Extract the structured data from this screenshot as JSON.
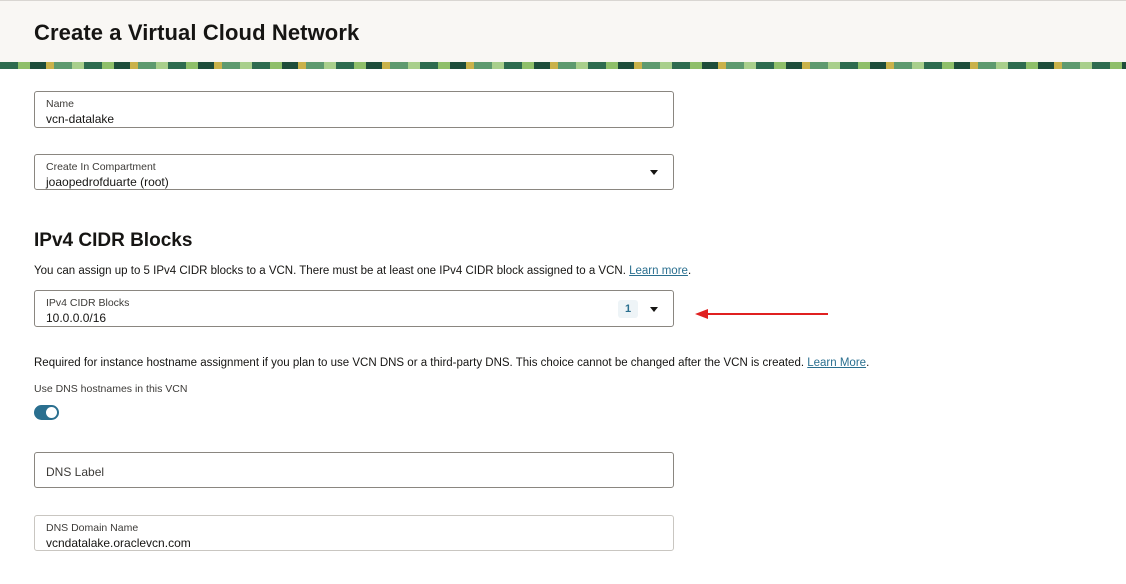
{
  "header": {
    "title": "Create a Virtual Cloud Network"
  },
  "form": {
    "name": {
      "label": "Name",
      "value": "vcn-datalake"
    },
    "compartment": {
      "label": "Create In Compartment",
      "value": "joaopedrofduarte (root)"
    }
  },
  "ipv4": {
    "section_title": "IPv4 CIDR Blocks",
    "help_text": "You can assign up to 5 IPv4 CIDR blocks to a VCN. There must be at least one IPv4 CIDR block assigned to a VCN.",
    "learn_more": "Learn more",
    "after_link": ".",
    "field": {
      "label": "IPv4 CIDR Blocks",
      "value": "10.0.0.0/16",
      "count": "1"
    }
  },
  "dns": {
    "help_text": "Required for instance hostname assignment if you plan to use VCN DNS or a third-party DNS. This choice cannot be changed after the VCN is created.",
    "learn_more": "Learn More",
    "after_link": ".",
    "toggle_label": "Use DNS hostnames in this VCN",
    "toggle_on": true,
    "label_field": {
      "label": "DNS Label"
    },
    "domain_field": {
      "label": "DNS Domain Name",
      "value": "vcndatalake.oraclevcn.com"
    }
  },
  "colors": {
    "accent": "#2a6f8f",
    "annotation_arrow": "#e02020",
    "header_bg": "#f9f7f4"
  }
}
